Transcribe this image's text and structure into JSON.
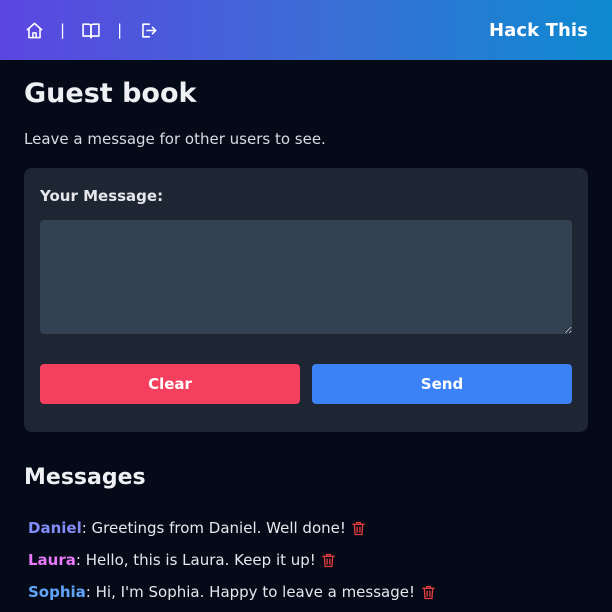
{
  "nav": {
    "brand": "Hack This",
    "separators": [
      "|",
      "|"
    ],
    "icons": [
      "home-icon",
      "book-icon",
      "logout-icon"
    ]
  },
  "page": {
    "title": "Guest book",
    "subtitle": "Leave a message for other users to see."
  },
  "form": {
    "label": "Your Message:",
    "message_value": "",
    "clear_label": "Clear",
    "send_label": "Send"
  },
  "messages": {
    "title": "Messages",
    "items": [
      {
        "author": "Daniel",
        "separator": ":",
        "text": " Greetings from Daniel. Well done!",
        "author_color": "#818cf8"
      },
      {
        "author": "Laura",
        "separator": ":",
        "text": " Hello, this is Laura. Keep it up!",
        "author_color": "#e879f9"
      },
      {
        "author": "Sophia",
        "separator": ":",
        "text": " Hi, I'm Sophia. Happy to leave a message!",
        "author_color": "#60a5fa"
      }
    ]
  },
  "colors": {
    "background": "#050a18",
    "card": "#1e2533",
    "input": "#334153",
    "clear_button": "#f43f5e",
    "send_button": "#3b82f6",
    "delete_icon": "#e53e3e",
    "navbar_gradient": [
      "#5b46e0",
      "#0d8ad0"
    ]
  }
}
